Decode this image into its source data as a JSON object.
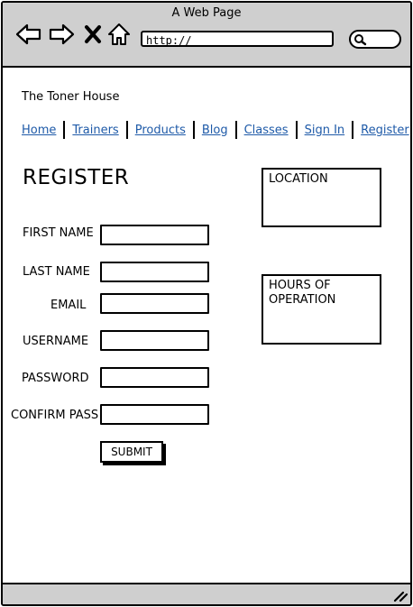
{
  "window": {
    "title": "A Web Page"
  },
  "browser": {
    "url": "http://"
  },
  "site": {
    "name": "The Toner House"
  },
  "nav": {
    "items": [
      {
        "label": "Home"
      },
      {
        "label": "Trainers"
      },
      {
        "label": "Products"
      },
      {
        "label": "Blog"
      },
      {
        "label": "Classes"
      },
      {
        "label": "Sign In"
      },
      {
        "label": "Register"
      }
    ]
  },
  "page": {
    "title": "REGISTER"
  },
  "form": {
    "first_name_label": "FIRST NAME",
    "last_name_label": "LAST NAME",
    "email_label": "EMAIL",
    "username_label": "USERNAME",
    "password_label": "PASSWORD",
    "confirm_label": "CONFIRM PASS",
    "submit_label": "SUBMIT"
  },
  "sidebar": {
    "location_label": "LOCATION",
    "hours_label": "HOURS OF OPERATION"
  },
  "icons": [
    "back-arrow-icon",
    "forward-arrow-icon",
    "close-icon",
    "home-icon",
    "search-icon",
    "resize-grip-icon"
  ]
}
